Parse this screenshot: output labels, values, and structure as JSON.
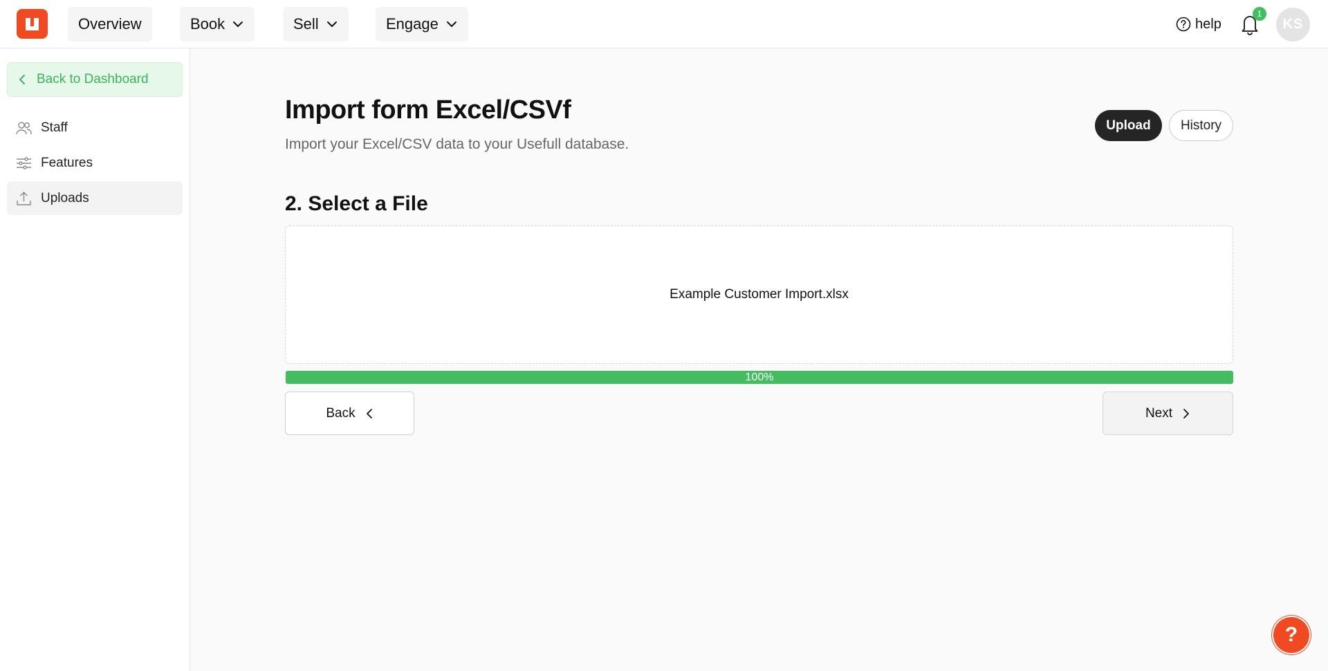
{
  "app": {
    "logo_icon": "app-logo-icon",
    "accent": "#f04a22",
    "success": "#44bd60"
  },
  "topnav": {
    "items": [
      {
        "label": "Overview"
      },
      {
        "label": "Book",
        "icon": "chevron-down-icon"
      },
      {
        "label": "Sell",
        "icon": "chevron-down-icon"
      },
      {
        "label": "Engage",
        "icon": "chevron-down-icon"
      }
    ],
    "help_label": "help",
    "notification_count": "1",
    "avatar_initials": "KS"
  },
  "sidebar": {
    "back_label": "Back to Dashboard",
    "items": [
      {
        "label": "Staff",
        "icon": "users-icon"
      },
      {
        "label": "Features",
        "icon": "sliders-icon"
      },
      {
        "label": "Uploads",
        "icon": "upload-icon",
        "active": true
      }
    ]
  },
  "main": {
    "title": "Import form Excel/CSVf",
    "subtitle": "Import your Excel/CSV data to your Usefull database.",
    "tabs": [
      {
        "label": "Upload",
        "active": true
      },
      {
        "label": "History",
        "active": false
      }
    ],
    "step_title": "2. Select a File",
    "file_name": "Example Customer Import.xlsx",
    "progress": {
      "value": 100,
      "label": "100%"
    },
    "back_label": "Back",
    "next_label": "Next",
    "help_fab_label": "?"
  }
}
